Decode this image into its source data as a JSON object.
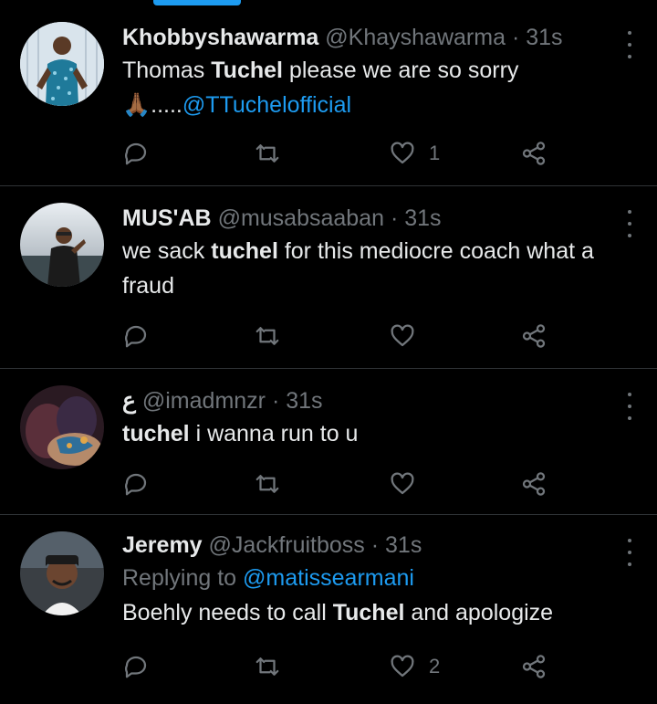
{
  "tweets": [
    {
      "name": "Khobbyshawarma",
      "handle": "@Khayshawarma",
      "dot": "·",
      "time": "31s",
      "replying_prefix": "",
      "replying_to": "",
      "body_parts": [
        "Thomas ",
        "Tuchel",
        " please we are so sorry"
      ],
      "body_line2_emoji": "🙏🏾",
      "body_line2_text": ".....",
      "body_line2_mention": "@TTuchelofficial",
      "likes": "1"
    },
    {
      "name": "MUS'AB",
      "handle": "@musabsaaban",
      "dot": "·",
      "time": "31s",
      "body_parts": [
        "we sack ",
        "tuchel",
        " for this mediocre coach what a fraud"
      ],
      "likes": ""
    },
    {
      "name": "ع",
      "handle": "@imadmnzr",
      "dot": "·",
      "time": "31s",
      "body_parts": [
        "",
        "tuchel",
        " i wanna run to u"
      ],
      "likes": ""
    },
    {
      "name": "Jeremy",
      "handle": "@Jackfruitboss",
      "dot": "·",
      "time": "31s",
      "replying_prefix": "Replying to",
      "replying_to": "@matissearmani",
      "body_parts": [
        "Boehly needs to call ",
        "Tuchel",
        " and apologize"
      ],
      "likes": "2"
    }
  ],
  "colors": {
    "accent": "#1d9bf0",
    "muted": "#71767b",
    "text": "#e7e9ea",
    "divider": "#2f3336"
  },
  "icons": {
    "reply": "reply-icon",
    "retweet": "retweet-icon",
    "like": "heart-icon",
    "share": "share-icon",
    "more": "more-icon"
  }
}
